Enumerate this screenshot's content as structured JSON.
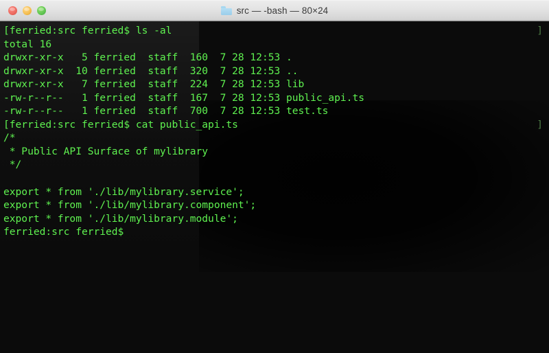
{
  "window": {
    "title": "src — -bash — 80×24",
    "folder_icon": "folder-icon",
    "traffic_lights": {
      "close_label": "close",
      "minimize_label": "minimize",
      "zoom_label": "zoom"
    }
  },
  "terminal": {
    "columns": 80,
    "rows": 24,
    "shell": "-bash",
    "cwd": "src",
    "foreground_color": "#5ff250",
    "background_color": "#0b0b0b",
    "prompt_bracket_left": "[",
    "prompt_bracket_right": "]",
    "lines": [
      "[ferried:src ferried$ ls -al",
      "total 16",
      "drwxr-xr-x   5 ferried  staff  160  7 28 12:53 .",
      "drwxr-xr-x  10 ferried  staff  320  7 28 12:53 ..",
      "drwxr-xr-x   7 ferried  staff  224  7 28 12:53 lib",
      "-rw-r--r--   1 ferried  staff  167  7 28 12:53 public_api.ts",
      "-rw-r--r--   1 ferried  staff  700  7 28 12:53 test.ts",
      "[ferried:src ferried$ cat public_api.ts",
      "/*",
      " * Public API Surface of mylibrary",
      " */",
      "",
      "export * from './lib/mylibrary.service';",
      "export * from './lib/mylibrary.component';",
      "export * from './lib/mylibrary.module';",
      "ferried:src ferried$"
    ],
    "right_markers": [
      {
        "row": 0,
        "glyph": "]"
      },
      {
        "row": 7,
        "glyph": "]"
      }
    ]
  }
}
